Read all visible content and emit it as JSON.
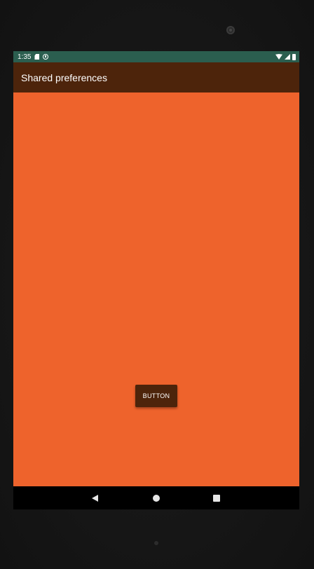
{
  "status_bar": {
    "time": "1:35",
    "left_icons": [
      "sd-card-icon",
      "sync-icon"
    ],
    "right_icons": [
      "wifi-icon",
      "signal-icon",
      "battery-icon"
    ],
    "color": "#2b5e4f"
  },
  "app_bar": {
    "title": "Shared preferences",
    "color": "#4d240b"
  },
  "content": {
    "background_color": "#ee632c",
    "button_label": "BUTTON",
    "button_color": "#4d240b"
  },
  "nav_bar": {
    "buttons": [
      "back-icon",
      "home-icon",
      "recents-icon"
    ]
  }
}
